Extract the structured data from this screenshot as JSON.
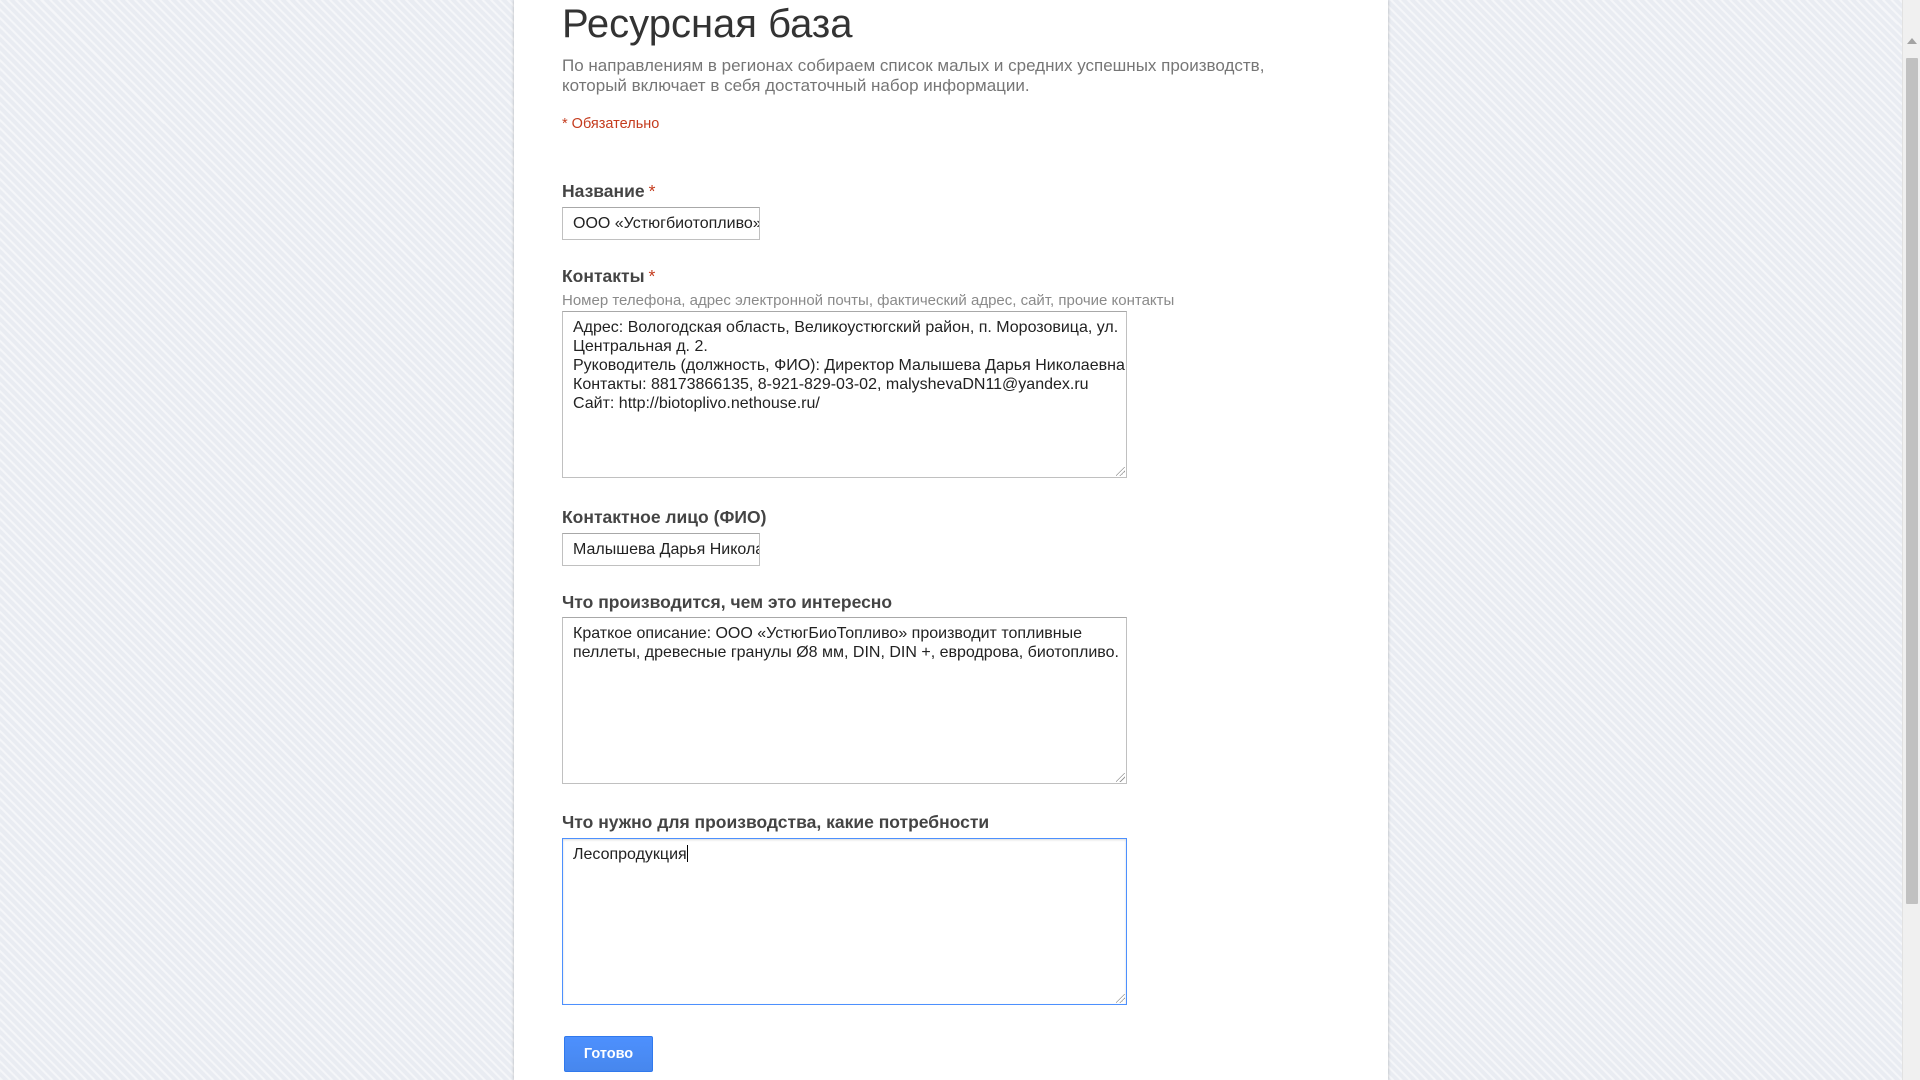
{
  "form": {
    "title": "Ресурсная база",
    "description_lines": [
      "По направлениям в регионах собираем список малых и средних успешных производств,",
      "который включает в себя достаточный набор информации."
    ],
    "required_note": "* Обязательно",
    "required_mark": "*",
    "fields": {
      "name": {
        "label": "Название",
        "value": "ООО «Устюгбиотопливо»"
      },
      "contacts": {
        "label": "Контакты",
        "help": "Номер телефона, адрес электронной почты, фактический адрес, сайт, прочие контакты",
        "lines": [
          "Адрес: Вологодская область, Великоустюгский район, п. Морозовица, ул.",
          "Центральная д. 2.",
          "Руководитель (должность, ФИО): Директор Малышева Дарья Николаевна",
          "Контакты: 88173866135, 8-921-829-03-02, malyshevaDN11@yandex.ru",
          "Сайт: http://biotoplivo.nethouse.ru/"
        ]
      },
      "contact_person": {
        "label": "Контактное лицо (ФИО)",
        "value": "Малышева Дарья Николаевна"
      },
      "product": {
        "label": "Что производится, чем это интересно",
        "lines": [
          "Краткое описание: ООО «УстюгБиоТопливо» производит топливные",
          "пеллеты, древесные гранулы Ø8 мм, DIN, DIN +, евродрова, биотопливо."
        ]
      },
      "needs": {
        "label": "Что нужно для производства, какие потребности",
        "value": "Лесопродукция"
      }
    },
    "submit_label": "Готово"
  }
}
